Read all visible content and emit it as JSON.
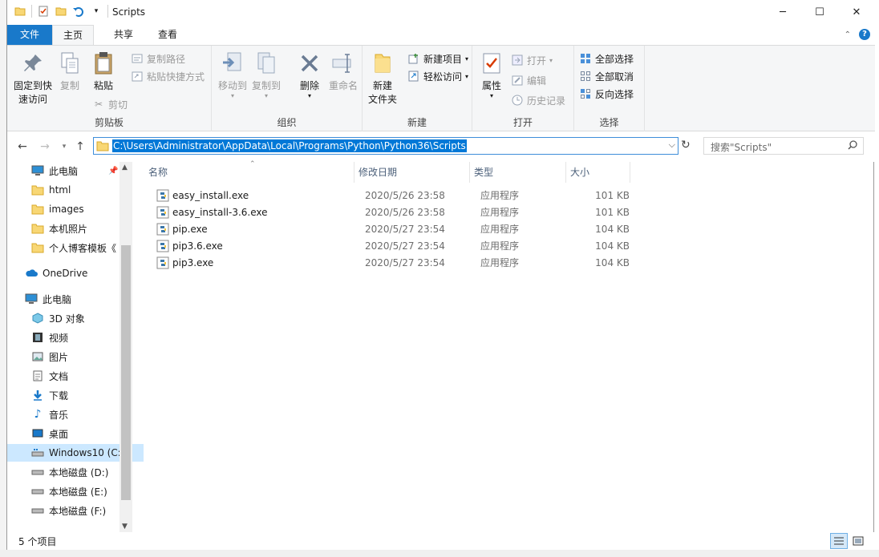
{
  "window": {
    "title": "Scripts",
    "minimize_glyph": "─",
    "maximize_glyph": "☐",
    "close_glyph": "✕"
  },
  "ribbon_tabs": [
    {
      "label": "文件"
    },
    {
      "label": "主页"
    },
    {
      "label": "共享"
    },
    {
      "label": "查看"
    }
  ],
  "ribbon": {
    "clipboard": {
      "label": "剪贴板",
      "pin": "固定到快\n速访问",
      "pin_line1": "固定到快",
      "pin_line2": "速访问",
      "copy": "复制",
      "paste": "粘贴",
      "copy_path": "复制路径",
      "paste_shortcut": "粘贴快捷方式",
      "cut": "剪切"
    },
    "organize": {
      "label": "组织",
      "move_to": "移动到",
      "copy_to": "复制到",
      "delete": "删除",
      "rename": "重命名"
    },
    "new": {
      "label": "新建",
      "new_folder_line1": "新建",
      "new_folder_line2": "文件夹",
      "new_item": "新建项目",
      "easy_access": "轻松访问"
    },
    "open": {
      "label": "打开",
      "properties": "属性",
      "open": "打开",
      "edit": "编辑",
      "history": "历史记录"
    },
    "select": {
      "label": "选择",
      "select_all": "全部选择",
      "select_none": "全部取消",
      "invert": "反向选择"
    }
  },
  "address": {
    "path": "C:\\Users\\Administrator\\AppData\\Local\\Programs\\Python\\Python36\\Scripts"
  },
  "search": {
    "placeholder": "搜索\"Scripts\""
  },
  "nav_items": [
    {
      "label": "此电脑",
      "icon": "computer-icon",
      "pinned": true
    },
    {
      "label": "html",
      "icon": "folder-icon"
    },
    {
      "label": "images",
      "icon": "folder-icon"
    },
    {
      "label": "本机照片",
      "icon": "folder-icon"
    },
    {
      "label": "个人博客模板《",
      "icon": "folder-icon"
    },
    {
      "label": "OneDrive",
      "icon": "cloud-icon"
    },
    {
      "label": "此电脑",
      "icon": "computer-icon"
    },
    {
      "label": "3D 对象",
      "icon": "cube-icon"
    },
    {
      "label": "视频",
      "icon": "video-icon"
    },
    {
      "label": "图片",
      "icon": "picture-icon"
    },
    {
      "label": "文档",
      "icon": "document-icon"
    },
    {
      "label": "下载",
      "icon": "download-icon"
    },
    {
      "label": "音乐",
      "icon": "music-icon"
    },
    {
      "label": "桌面",
      "icon": "desktop-icon"
    },
    {
      "label": "Windows10 (C:",
      "icon": "drive-c-icon",
      "selected": true
    },
    {
      "label": "本地磁盘 (D:)",
      "icon": "drive-icon"
    },
    {
      "label": "本地磁盘 (E:)",
      "icon": "drive-icon"
    },
    {
      "label": "本地磁盘 (F:)",
      "icon": "drive-icon"
    }
  ],
  "columns": [
    "名称",
    "修改日期",
    "类型",
    "大小"
  ],
  "files": [
    {
      "name": "easy_install.exe",
      "date": "2020/5/26 23:58",
      "type": "应用程序",
      "size": "101 KB"
    },
    {
      "name": "easy_install-3.6.exe",
      "date": "2020/5/26 23:58",
      "type": "应用程序",
      "size": "101 KB"
    },
    {
      "name": "pip.exe",
      "date": "2020/5/27 23:54",
      "type": "应用程序",
      "size": "104 KB"
    },
    {
      "name": "pip3.6.exe",
      "date": "2020/5/27 23:54",
      "type": "应用程序",
      "size": "104 KB"
    },
    {
      "name": "pip3.exe",
      "date": "2020/5/27 23:54",
      "type": "应用程序",
      "size": "104 KB"
    }
  ],
  "status": {
    "item_count": "5 个项目"
  }
}
